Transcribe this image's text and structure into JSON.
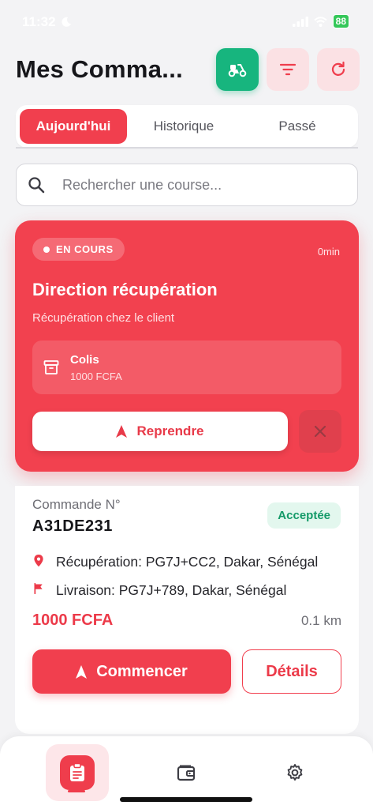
{
  "status_bar": {
    "time": "11:32",
    "battery": "88"
  },
  "header": {
    "title": "Mes Comma..."
  },
  "tabs": [
    {
      "label": "Aujourd'hui",
      "active": true
    },
    {
      "label": "Historique",
      "active": false
    },
    {
      "label": "Passé",
      "active": false
    }
  ],
  "search": {
    "placeholder": "Rechercher une course..."
  },
  "active_delivery": {
    "status": "EN COURS",
    "elapsed": "0min",
    "title": "Direction récupération",
    "subtitle": "Récupération chez le client",
    "package_type": "Colis",
    "package_price": "1000 FCFA",
    "resume_label": "Reprendre"
  },
  "order": {
    "label": "Commande N°",
    "id": "A31DE231",
    "status": "Acceptée",
    "pickup": "Récupération: PG7J+CC2, Dakar, Sénégal",
    "dropoff": "Livraison: PG7J+789, Dakar, Sénégal",
    "price": "1000 FCFA",
    "distance": "0.1 km",
    "start_label": "Commencer",
    "details_label": "Détails"
  },
  "colors": {
    "accent": "#f13f4e",
    "success": "#17b57e"
  },
  "icons": [
    "moon-icon",
    "signal-icon",
    "wifi-icon",
    "scooter-icon",
    "filter-icon",
    "refresh-icon",
    "search-icon",
    "package-icon",
    "navigation-icon",
    "close-icon",
    "location-pin-icon",
    "flag-icon",
    "clipboard-icon",
    "wallet-icon",
    "gear-icon"
  ]
}
